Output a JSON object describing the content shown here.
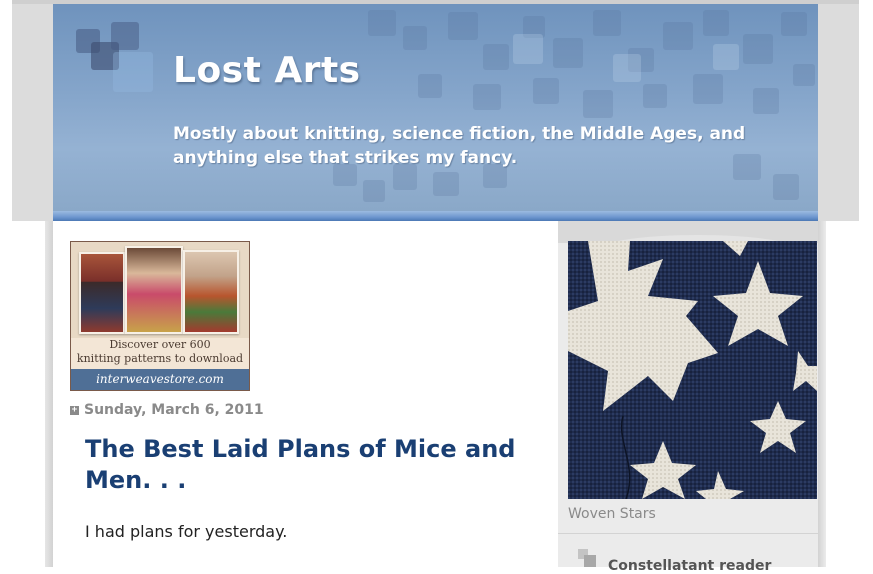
{
  "header": {
    "title": "Lost Arts",
    "description": "Mostly about knitting, science fiction, the Middle Ages, and anything else that strikes my fancy."
  },
  "ad": {
    "text_line1": "Discover over 600",
    "text_line2": "knitting patterns to download",
    "footer": "interweavestore.com"
  },
  "post": {
    "date": "Sunday, March 6, 2011",
    "title": "The Best Laid Plans of Mice and Men. . .",
    "body_first_line": "I had plans for yesterday."
  },
  "sidebar": {
    "photo_caption": "Woven Stars",
    "next_widget_title": "Constellatant reader"
  },
  "icons": {
    "collapse": "collapse-square-icon",
    "header_logo": "squares-logo-icon"
  },
  "colors": {
    "header_blue": "#86a6cb",
    "post_title": "#1a3f73",
    "date_gray": "#8a8a8a",
    "sidebar_bg": "#ebebeb"
  }
}
